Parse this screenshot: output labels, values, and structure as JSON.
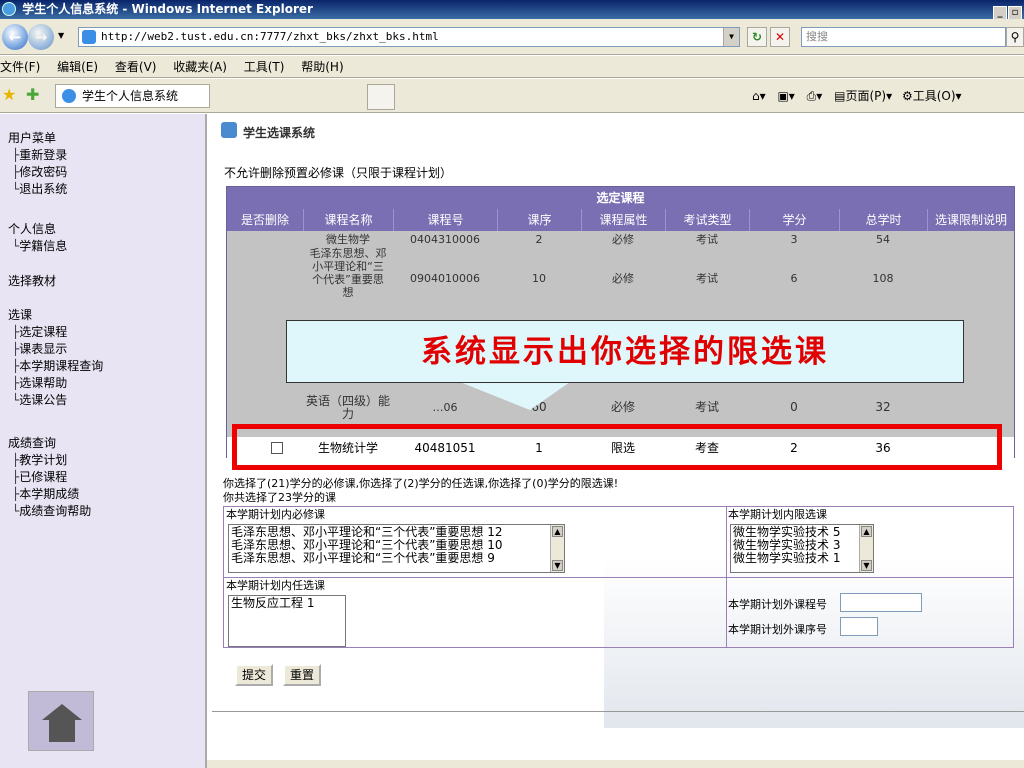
{
  "window": {
    "title": "学生个人信息系统 - Windows Internet Explorer"
  },
  "address_bar": {
    "url": "http://web2.tust.edu.cn:7777/zhxt_bks/zhxt_bks.html",
    "search_placeholder": "搜搜"
  },
  "menu": [
    "文件(F)",
    "编辑(E)",
    "查看(V)",
    "收藏夹(A)",
    "工具(T)",
    "帮助(H)"
  ],
  "tab": {
    "label": "学生个人信息系统"
  },
  "command_bar": {
    "page_label": "页面(P)",
    "tools_label": "工具(O)"
  },
  "sidebar": {
    "user_menu": {
      "title": "用户菜单",
      "items": [
        "重新登录",
        "修改密码",
        "退出系统"
      ]
    },
    "personal": {
      "title": "个人信息",
      "items": [
        "学籍信息"
      ]
    },
    "textbooks": {
      "title": "选择教材"
    },
    "courses": {
      "title": "选课",
      "items": [
        "选定课程",
        "课表显示",
        "本学期课程查询",
        "选课帮助",
        "选课公告"
      ]
    },
    "grades": {
      "title": "成绩查询",
      "items": [
        "教学计划",
        "已修课程",
        "本学期成绩",
        "成绩查询帮助"
      ]
    }
  },
  "main": {
    "system_title": "学生选课系统",
    "note": "不允许删除预置必修课（只限于课程计划）",
    "table": {
      "caption": "选定课程",
      "headers": [
        "是否删除",
        "课程名称",
        "课程号",
        "课序",
        "课程属性",
        "考试类型",
        "学分",
        "总学时",
        "选课限制说明"
      ],
      "rows_visible": [
        {
          "name": "微生物学",
          "code": "0404310006",
          "seq": "2",
          "attr": "必修",
          "exam": "考试",
          "credit": "3",
          "hours": "54"
        },
        {
          "name": "毛泽东思想、邓小平理论和“三个代表”重要思想",
          "code": "0904010006",
          "seq": "10",
          "attr": "必修",
          "exam": "考试",
          "credit": "6",
          "hours": "108"
        },
        {
          "name": "英语（四级）能力",
          "code": "…06",
          "seq": "60",
          "attr": "必修",
          "exam": "考试",
          "credit": "0",
          "hours": "32"
        }
      ],
      "highlighted_row": {
        "name": "生物统计学",
        "code": "40481051",
        "seq": "1",
        "attr": "限选",
        "exam": "考查",
        "credit": "2",
        "hours": "36"
      }
    },
    "callout": "系统显示出你选择的限选课",
    "summary_line1": "你选择了(21)学分的必修课,你选择了(2)学分的任选课,你选择了(0)学分的限选课!",
    "summary_line2": "你共选择了23学分的课",
    "required_plan": {
      "label": "本学期计划内必修课",
      "items": [
        "毛泽东思想、邓小平理论和“三个代表”重要思想 12",
        "毛泽东思想、邓小平理论和“三个代表”重要思想 10",
        "毛泽东思想、邓小平理论和“三个代表”重要思想 9"
      ]
    },
    "restricted_plan": {
      "label": "本学期计划内限选课",
      "items": [
        "微生物学实验技术 5",
        "微生物学实验技术 3",
        "微生物学实验技术 1"
      ]
    },
    "elective_plan": {
      "label": "本学期计划内任选课",
      "items": [
        "生物反应工程 1"
      ]
    },
    "outside_course_no": {
      "label": "本学期计划外课程号"
    },
    "outside_seq_no": {
      "label": "本学期计划外课序号"
    },
    "submit": "提交",
    "reset": "重置"
  }
}
